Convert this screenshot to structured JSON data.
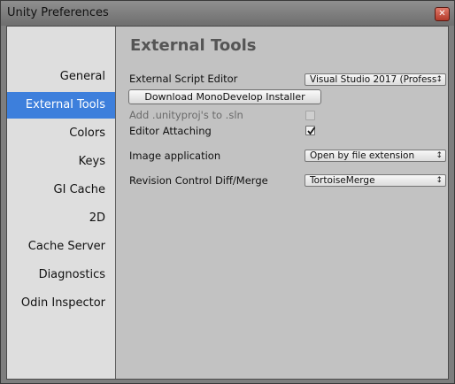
{
  "window": {
    "title": "Unity Preferences",
    "close_glyph": "✕"
  },
  "sidebar": {
    "items": [
      {
        "label": "General",
        "active": false
      },
      {
        "label": "External Tools",
        "active": true
      },
      {
        "label": "Colors",
        "active": false
      },
      {
        "label": "Keys",
        "active": false
      },
      {
        "label": "GI Cache",
        "active": false
      },
      {
        "label": "2D",
        "active": false
      },
      {
        "label": "Cache Server",
        "active": false
      },
      {
        "label": "Diagnostics",
        "active": false
      },
      {
        "label": "Odin Inspector",
        "active": false
      }
    ]
  },
  "main": {
    "heading": "External Tools",
    "script_editor": {
      "label": "External Script Editor",
      "value": "Visual Studio 2017 (Profess"
    },
    "download_button": "Download MonoDevelop Installer",
    "add_unityproj": {
      "label": "Add .unityproj's to .sln",
      "checked": false,
      "enabled": false
    },
    "editor_attaching": {
      "label": "Editor Attaching",
      "checked": true
    },
    "image_application": {
      "label": "Image application",
      "value": "Open by file extension"
    },
    "revision_control": {
      "label": "Revision Control Diff/Merge",
      "value": "TortoiseMerge"
    }
  },
  "colors": {
    "accent": "#3d7fdc",
    "sidebar_bg": "#dedede",
    "panel_bg": "#c2c2c2"
  },
  "icons": {
    "dropdown": "chevron-down-icon",
    "close": "close-icon",
    "check": "checkmark-icon"
  }
}
